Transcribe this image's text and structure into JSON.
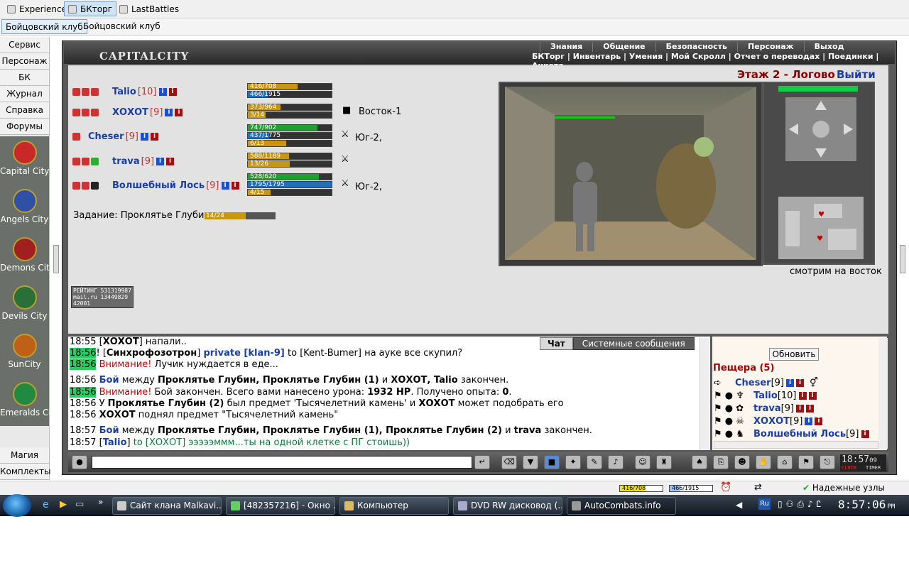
{
  "bookmarks": [
    {
      "label": "Experience"
    },
    {
      "label": "БКторг"
    },
    {
      "label": "LastBattles"
    }
  ],
  "tabs": [
    {
      "label": "Бойцовский клуб"
    },
    {
      "label": "Бойцовский клуб"
    }
  ],
  "leftmenu": [
    "Сервис",
    "Персонаж",
    "БК",
    "Журнал",
    "Справка",
    "Форумы"
  ],
  "cities": [
    "Capital City",
    "Angels City",
    "Demons City",
    "Devils City",
    "SunCity",
    "Emeralds City"
  ],
  "leftmenu_bottom": [
    "Магия",
    "Комплекты"
  ],
  "game": {
    "logo": "CAPITALCITY",
    "nav_top": [
      "Знания",
      "Общение",
      "Безопасность",
      "Персонаж",
      "Выход"
    ],
    "nav_bottom": "БКТорг | Инвентарь | Умения | Мой Скролл | Отчет о переводах | Поединки | Анкета",
    "floor": "Этаж 2 - Логово",
    "exit": "Выйти",
    "looking": "смотрим на восток",
    "task_label": "Задание: Проклятье Глубин",
    "task_progress": "14/24",
    "task_fraction": 0.58,
    "rating_text": "РЕЙТИНГ 531319987 mail.ru 13449829 42001"
  },
  "party": [
    {
      "name": "Talio",
      "level": "[10]",
      "bars": [
        {
          "text": "416/708",
          "frac": 0.59,
          "color": "#c9960f"
        },
        {
          "text": "466/1915",
          "frac": 0.24,
          "color": "#1f6fc0"
        }
      ],
      "loc": ""
    },
    {
      "name": "ХОХОТ",
      "level": "[9]",
      "bars": [
        {
          "text": "373/964",
          "frac": 0.39,
          "color": "#c9960f"
        },
        {
          "text": "3/14",
          "frac": 0.21,
          "color": "#c9960f"
        }
      ],
      "loc": "Восток-1"
    },
    {
      "name": "Cheser",
      "level": "[9]",
      "bars": [
        {
          "text": "747/902",
          "frac": 0.83,
          "color": "#1fa030"
        },
        {
          "text": "437/1775",
          "frac": 0.25,
          "color": "#1f6fc0"
        },
        {
          "text": "6/13",
          "frac": 0.46,
          "color": "#c9960f"
        }
      ],
      "loc": "Юг-2,"
    },
    {
      "name": "trava",
      "level": "[9]",
      "bars": [
        {
          "text": "588/1189",
          "frac": 0.49,
          "color": "#c9960f"
        },
        {
          "text": "13/26",
          "frac": 0.5,
          "color": "#c9960f"
        }
      ],
      "loc": ""
    },
    {
      "name": "Волшебный Лось",
      "level": "[9]",
      "bars": [
        {
          "text": "528/620",
          "frac": 0.85,
          "color": "#1fa030"
        },
        {
          "text": "1795/1795",
          "frac": 1.0,
          "color": "#1f6fc0"
        },
        {
          "text": "4/15",
          "frac": 0.27,
          "color": "#c9960f"
        }
      ],
      "loc": "Юг-2,"
    }
  ],
  "chat": {
    "tab_chat": "Чат",
    "tab_system": "Системные сообщения",
    "lines": [
      {
        "t": "18:55",
        "parts": [
          [
            "",
            " ["
          ],
          [
            "nm",
            "ХОХОТ"
          ],
          [
            "",
            "] напали.."
          ]
        ]
      },
      {
        "t": "18:56",
        "g": true,
        "parts": [
          [
            "",
            "! ["
          ],
          [
            "nm",
            "Синхрофозотрон"
          ],
          [
            "",
            "] "
          ],
          [
            "priv",
            "private [klan-9]"
          ],
          [
            "",
            " to [Kent-Bumer] на ауке все скупил?"
          ]
        ]
      },
      {
        "t": "18:56",
        "g": true,
        "parts": [
          [
            "",
            " "
          ],
          [
            "warn",
            "Внимание!"
          ],
          [
            "",
            " Лучик нуждается в еде..."
          ]
        ]
      },
      {
        "t": "18:56",
        "parts": [
          [
            "",
            " "
          ],
          [
            "blue",
            "Бой"
          ],
          [
            "",
            " между "
          ],
          [
            "bold",
            "Проклятье Глубин, Проклятье Глубин (1)"
          ],
          [
            "",
            " и "
          ],
          [
            "bold",
            "ХОХОТ, Talio"
          ],
          [
            "",
            " закончен."
          ]
        ]
      },
      {
        "t": "18:56",
        "g": true,
        "parts": [
          [
            "",
            " "
          ],
          [
            "warn",
            "Внимание!"
          ],
          [
            "",
            " Бой закончен. Всего вами нанесено урона: "
          ],
          [
            "bold",
            "1932 HP"
          ],
          [
            "",
            ". Получено опыта: "
          ],
          [
            "bold",
            "0"
          ],
          [
            "",
            "."
          ]
        ]
      },
      {
        "t": "18:56",
        "parts": [
          [
            "",
            " У "
          ],
          [
            "bold",
            "Проклятье Глубин (2)"
          ],
          [
            "",
            " был предмет 'Тысячелетний камень' и "
          ],
          [
            "bold",
            "ХОХОТ"
          ],
          [
            "",
            " может подобрать его"
          ]
        ]
      },
      {
        "t": "18:56",
        "parts": [
          [
            "",
            " "
          ],
          [
            "bold",
            "ХОХОТ"
          ],
          [
            "",
            " поднял предмет \"Тысячелетний камень\""
          ]
        ]
      },
      {
        "t": "18:57",
        "parts": [
          [
            "",
            " "
          ],
          [
            "blue",
            "Бой"
          ],
          [
            "",
            " между "
          ],
          [
            "bold",
            "Проклятье Глубин, Проклятье Глубин (1), Проклятье Глубин (2)"
          ],
          [
            "",
            " и "
          ],
          [
            "bold",
            "trava"
          ],
          [
            "",
            " закончен."
          ]
        ]
      },
      {
        "t": "18:57",
        "parts": [
          [
            "",
            " ["
          ],
          [
            "blue",
            "Talio"
          ],
          [
            "",
            "] "
          ],
          [
            "grn",
            "to [ХОХОТ] эээээммм...ты на одной клетке с ПГ стоишь))"
          ]
        ]
      }
    ]
  },
  "online": {
    "refresh": "Обновить",
    "title": "Пещера (5)",
    "people": [
      {
        "name": "Cheser",
        "level": "[9]"
      },
      {
        "name": "Talio",
        "level": "[10]"
      },
      {
        "name": "trava",
        "level": "[9]"
      },
      {
        "name": "ХОХОТ",
        "level": "[9]"
      },
      {
        "name": "Волшебный Лось",
        "level": "[9]"
      }
    ]
  },
  "clock": {
    "time": "18:57",
    "sec": "09",
    "clock_label": "CLOCK",
    "timer_label": "TIMER"
  },
  "status": {
    "hp": "416/708",
    "hp_frac": 0.59,
    "mana": "466/1915",
    "mana_frac": 0.24,
    "reliable": "Надежные узлы"
  },
  "taskbar": {
    "items": [
      "Сайт клана Malkavi...",
      "[482357216] - Окно ...",
      "Компьютер",
      "DVD RW дисковод (...",
      "AutoCombats.info"
    ],
    "lang": "Ru",
    "time": "8:57:06",
    "ampm": "PM"
  }
}
